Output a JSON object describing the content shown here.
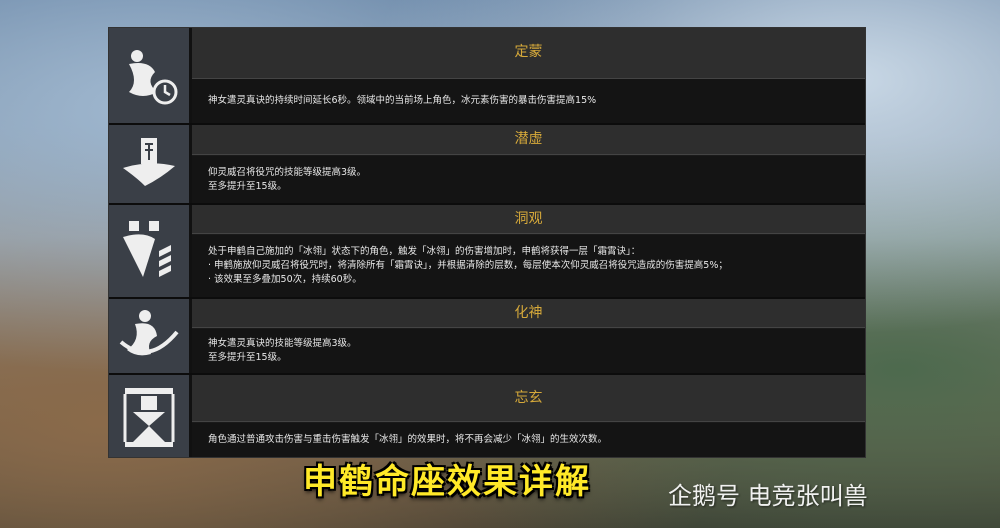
{
  "constellations": [
    {
      "title": "定蒙",
      "lines": [
        "神女遣灵真诀的持续时间延长6秒。领域中的当前场上角色，冰元素伤害的暴击伤害提高15%"
      ]
    },
    {
      "title": "潜虚",
      "lines": [
        "仰灵威召将役咒的技能等级提高3级。",
        "至多提升至15级。"
      ]
    },
    {
      "title": "洞观",
      "lines": [
        "处于申鹤自己施加的「冰翎」状态下的角色，触发「冰翎」的伤害增加时，申鹤将获得一层「霜霄诀」：",
        "· 申鹤施放仰灵威召将役咒时，将清除所有「霜霄诀」，并根据清除的层数，每层使本次仰灵威召将役咒造成的伤害提高5%；",
        "· 该效果至多叠加50次，持续60秒。"
      ]
    },
    {
      "title": "化神",
      "lines": [
        "神女遣灵真诀的技能等级提高3级。",
        "至多提升至15级。"
      ]
    },
    {
      "title": "忘玄",
      "lines": [
        "角色通过普通攻击伤害与重击伤害触发「冰翎」的效果时，将不再会减少「冰翎」的生效次数。"
      ]
    }
  ],
  "caption": "申鹤命座效果详解",
  "watermark": "企鹅号 电竞张叫兽",
  "icons": [
    "dingmeng-constellation-icon",
    "qianxu-constellation-icon",
    "dongguan-constellation-icon",
    "huashen-constellation-icon",
    "wangxuan-constellation-icon"
  ]
}
